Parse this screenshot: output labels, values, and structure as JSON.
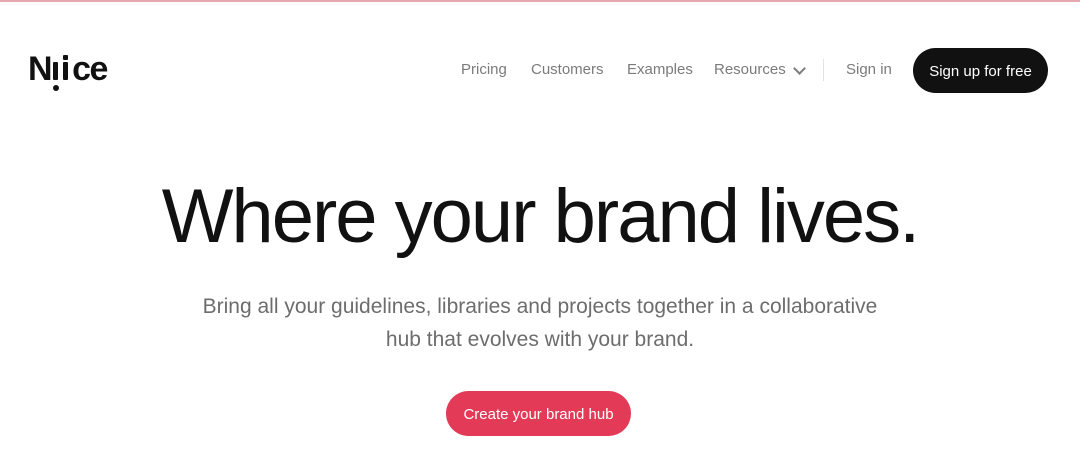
{
  "brand": {
    "logo_left": "N",
    "logo_right": "ce",
    "accent_color": "#e23a57",
    "top_line_color": "#e7a9b1"
  },
  "nav": {
    "items": [
      {
        "label": "Pricing"
      },
      {
        "label": "Customers"
      },
      {
        "label": "Examples"
      },
      {
        "label": "Resources",
        "icon": "chevron-down-icon"
      }
    ],
    "signin_label": "Sign in",
    "signup_label": "Sign up for free"
  },
  "hero": {
    "title": "Where your brand lives.",
    "subtitle": "Bring all your guidelines, libraries and projects together in a collaborative hub that evolves with your brand.",
    "cta_label": "Create your brand hub"
  }
}
